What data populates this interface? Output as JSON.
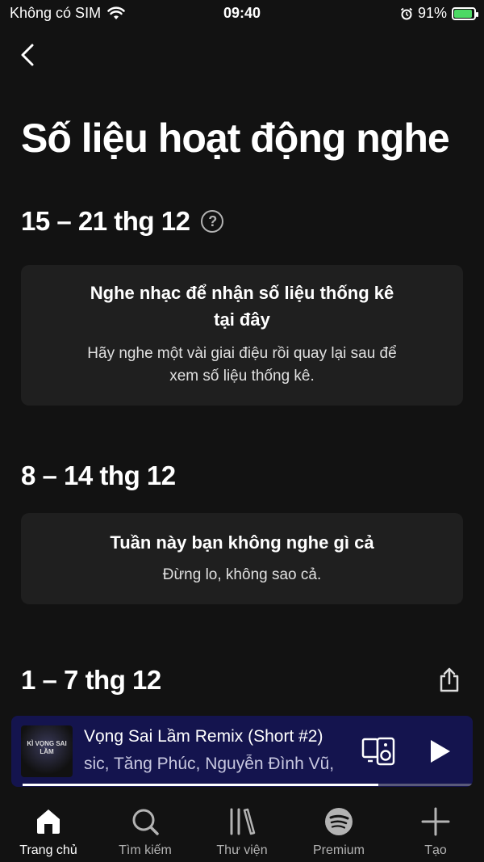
{
  "status_bar": {
    "carrier": "Không có SIM",
    "time": "09:40",
    "battery": "91%",
    "battery_level": 0.91
  },
  "page": {
    "title": "Số liệu hoạt động nghe"
  },
  "weeks": [
    {
      "range": "15 – 21 thg 12",
      "card_title_line1": "Nghe nhạc để nhận số liệu thống kê",
      "card_title_line2": "tại đây",
      "card_sub_line1": "Hãy nghe một vài giai điệu rồi quay lại sau để",
      "card_sub_line2": "xem số liệu thống kê."
    },
    {
      "range": "8 – 14 thg 12",
      "card_title": "Tuần này bạn không nghe gì cả",
      "card_sub": "Đừng lo, không sao cả."
    },
    {
      "range": "1 – 7 thg 12"
    }
  ],
  "player": {
    "track": "Vọng Sai Lầm Remix (Short #2)",
    "artists": "sic, Tăng Phúc, Nguyễn Đình Vũ,",
    "art_text": "KÌ VỌNG SAI LẦM",
    "progress": 0.79
  },
  "nav": {
    "home": "Trang chủ",
    "search": "Tìm kiếm",
    "library": "Thư viện",
    "premium": "Premium",
    "create": "Tạo"
  },
  "colors": {
    "background": "#121212",
    "card": "#1f1f1f",
    "player": "#14144e",
    "battery_green": "#4cd964"
  }
}
